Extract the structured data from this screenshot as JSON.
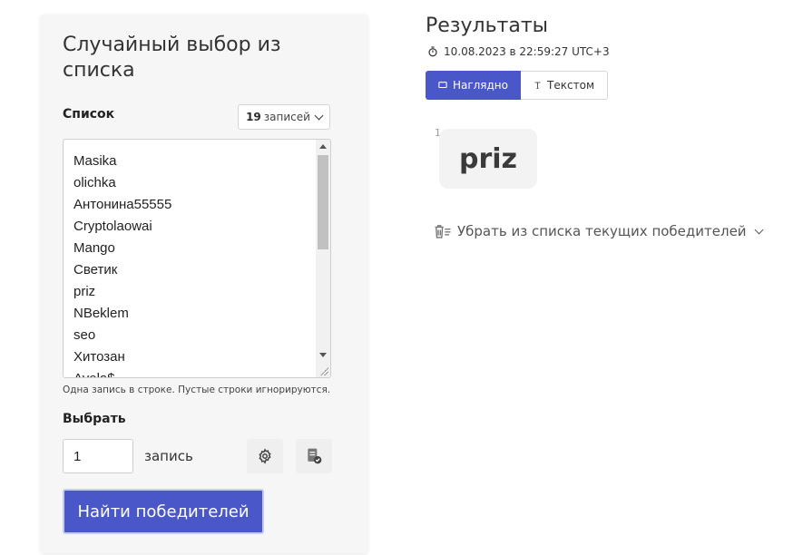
{
  "left_panel": {
    "title": "Случайный выбор из списка",
    "list_label": "Список",
    "entries_count": "19",
    "entries_word": "записей",
    "entries": [
      "Masika",
      "olichka",
      "Антонина55555",
      "Cryptolaowai",
      "Mango",
      "Светик",
      "priz",
      "NBeklem",
      "seo",
      "Хитозан",
      "Avela$"
    ],
    "hint": "Одна запись в строке. Пустые строки игнорируются.",
    "choose_label": "Выбрать",
    "quantity_value": "1",
    "quantity_unit": "запись",
    "find_button": "Найти победителей"
  },
  "results": {
    "title": "Результаты",
    "date": "10.08.2023 в 22:59:27 UTC+3",
    "tab_visual": "Наглядно",
    "tab_text": "Текстом",
    "winner_index": "1",
    "winner_name": "priz",
    "remove_label": "Убрать из списка текущих победителей"
  },
  "colors": {
    "accent": "#4a57c8",
    "card_bg": "#f6f6f6"
  },
  "icons": [
    "timer-icon",
    "display-icon",
    "text-icon",
    "gear-icon",
    "doc-check-icon",
    "trash-list-icon",
    "chevron-down-icon"
  ]
}
